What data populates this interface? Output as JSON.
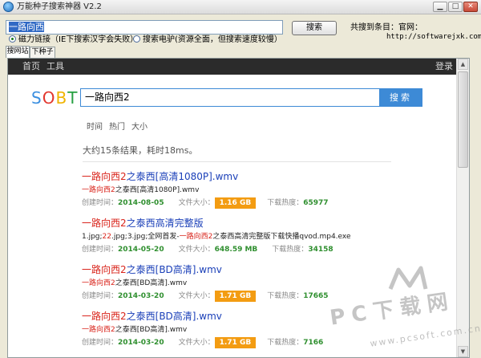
{
  "window": {
    "title": "万能种子搜索神器 V2.2"
  },
  "toolbar": {
    "search_value": "一路向西",
    "search_button": "搜索",
    "result_count": "共搜到条目：官网：",
    "site_url": "http://softwarejxk.com",
    "radio_magnet": "磁力链接（IE下搜索汉字会失败）",
    "radio_donkey": "搜索电驴(资源全面，但搜索速度较慢）"
  },
  "tabs": [
    {
      "label": "搜网站"
    },
    {
      "label": "下种子"
    }
  ],
  "site": {
    "nav": {
      "home": "首页",
      "tools": "工具",
      "login": "登录"
    },
    "logo": {
      "s": "S",
      "o": "O",
      "b": "B",
      "t": "T"
    },
    "query": "一路向西2",
    "query_button": "搜索",
    "filters": [
      "时间",
      "热门",
      "大小"
    ],
    "summary": "大约15条结果，耗时18ms。",
    "labels": {
      "created": "创建时间：",
      "size": "文件大小：",
      "heat": "下载热度："
    },
    "results": [
      {
        "title_hl": "一路向西2",
        "title_rest": "之泰西[高清1080P].wmv",
        "file_hl": "一路向西2",
        "file_rest": "之泰西[高清1080P].wmv",
        "date": "2014-08-05",
        "size": "1.16 GB",
        "size_highlight": true,
        "heat": "65977"
      },
      {
        "title_hl": "一路向西2",
        "title_rest": "之泰西高清完整版",
        "file_pre": "1.jpg;",
        "file_num": "22",
        "file_mid": ".jpg;3.jpg;全网首发-",
        "file_hl": "一路向西2",
        "file_rest": "之泰西高清完整版下载快播qvod.mp4.exe",
        "date": "2014-05-20",
        "size": "648.59 MB",
        "size_highlight": false,
        "heat": "34158"
      },
      {
        "title_hl": "一路向西2",
        "title_rest": "之泰西[BD高清].wmv",
        "file_hl": "一路向西2",
        "file_rest": "之泰西[BD高清].wmv",
        "date": "2014-03-20",
        "size": "1.71 GB",
        "size_highlight": true,
        "heat": "17665"
      },
      {
        "title_hl": "一路向西2",
        "title_rest": "之泰西[BD高清].wmv",
        "file_hl": "一路向西2",
        "file_rest": "之泰西[BD高清].wmv",
        "date": "2014-03-20",
        "size": "1.71 GB",
        "size_highlight": true,
        "heat": "7166"
      }
    ]
  },
  "watermark": {
    "text": "PC下载网",
    "url": "www.pcsoft.com.cn"
  },
  "colors": {
    "accent": "#3d8ad6",
    "highlight": "#d9251c",
    "link": "#1a3fb8",
    "size_badge": "#f39c12",
    "green": "#2f8f2f"
  }
}
